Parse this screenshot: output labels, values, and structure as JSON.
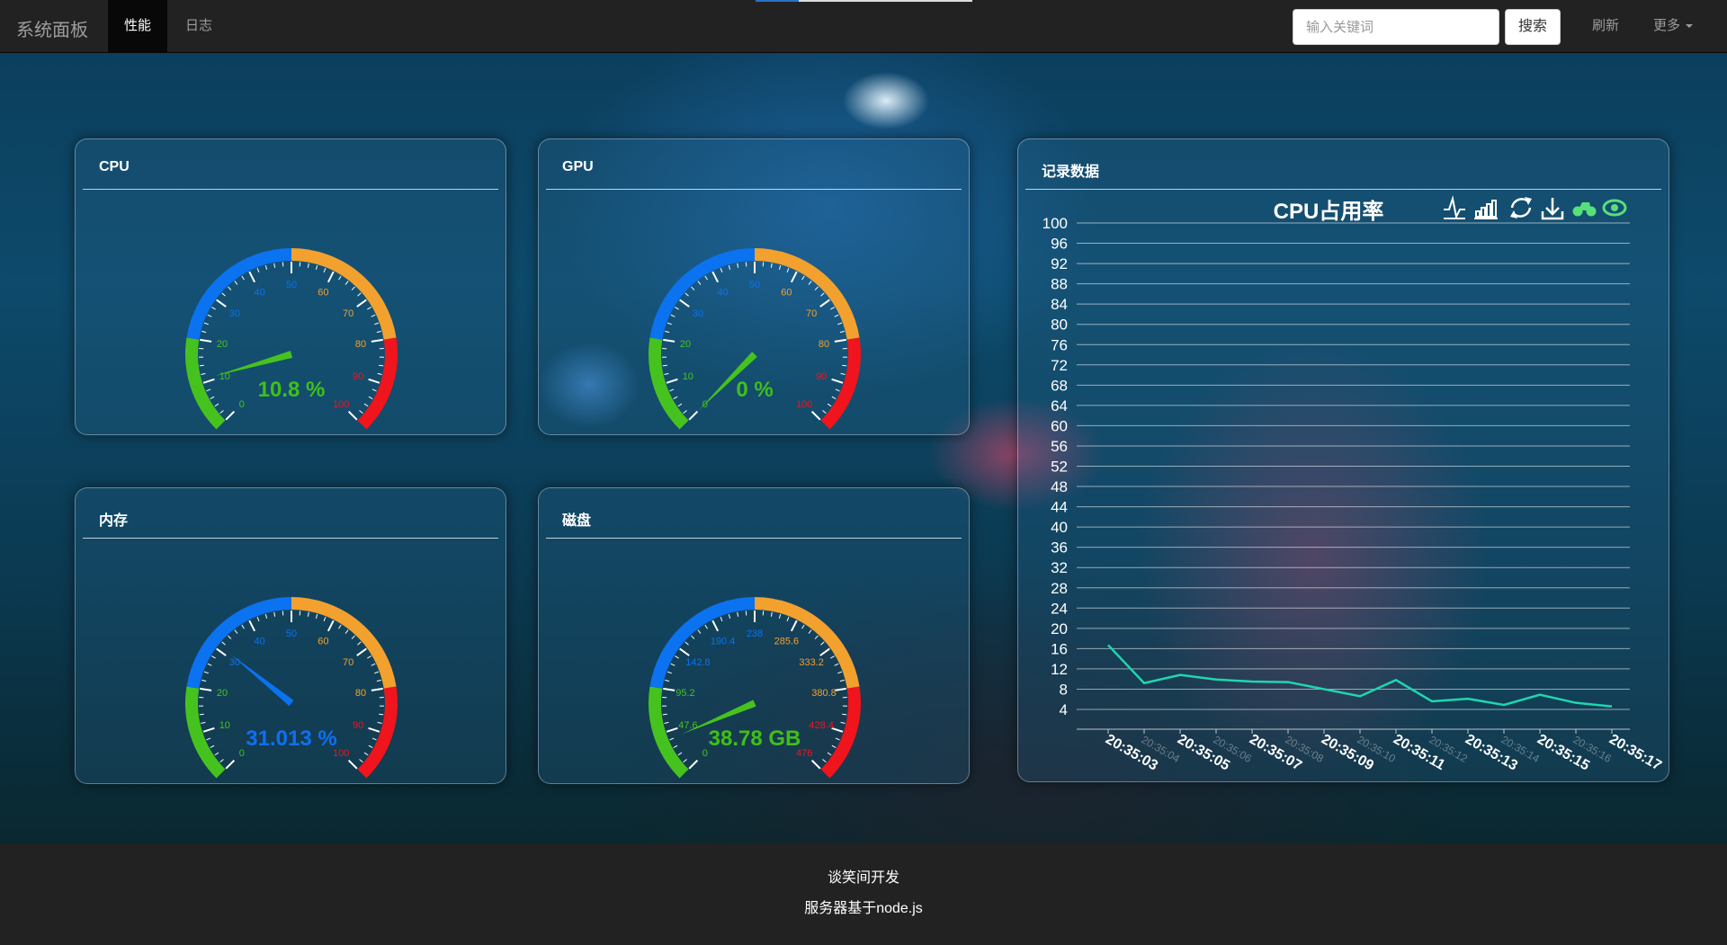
{
  "nav": {
    "brand": "系统面板",
    "tabs": [
      {
        "label": "性能",
        "active": true
      },
      {
        "label": "日志",
        "active": false
      }
    ],
    "search_placeholder": "输入关键词",
    "search_button": "搜索",
    "refresh": "刷新",
    "more": "更多"
  },
  "gauges": [
    {
      "title": "CPU",
      "value": 10.8,
      "display": "10.8 %",
      "min": 0,
      "max": 100,
      "ticks": [
        "0",
        "10",
        "20",
        "30",
        "40",
        "50",
        "60",
        "70",
        "80",
        "90",
        "100"
      ],
      "value_color": "#3fbf1a"
    },
    {
      "title": "GPU",
      "value": 0,
      "display": "0 %",
      "min": 0,
      "max": 100,
      "ticks": [
        "0",
        "10",
        "20",
        "30",
        "40",
        "50",
        "60",
        "70",
        "80",
        "90",
        "100"
      ],
      "value_color": "#3fbf1a"
    },
    {
      "title": "内存",
      "value": 31.013,
      "display": "31.013 %",
      "min": 0,
      "max": 100,
      "ticks": [
        "0",
        "10",
        "20",
        "30",
        "40",
        "50",
        "60",
        "70",
        "80",
        "90",
        "100"
      ],
      "value_color": "#0f6ff2"
    },
    {
      "title": "磁盘",
      "value": 38.78,
      "display": "38.78 GB",
      "min": 0,
      "max": 476,
      "ticks": [
        "0",
        "47.6",
        "95.2",
        "142.8",
        "190.4",
        "238",
        "285.6",
        "333.2",
        "380.8",
        "428.4",
        "476"
      ],
      "value_color": "#3fbf1a"
    }
  ],
  "colors": {
    "green": "#46c21f",
    "blue": "#0b72f0",
    "orange": "#f2a12e",
    "red": "#f0141c",
    "line": "#1fd6b0",
    "toolbox": "#56e07a"
  },
  "record_panel": {
    "title": "记录数据"
  },
  "chart_data": {
    "type": "line",
    "title": "CPU占用率",
    "toolbox_icons": [
      "line-chart-icon",
      "bar-chart-icon",
      "restore-icon",
      "download-icon",
      "bike-icon",
      "eye-icon"
    ],
    "x": [
      "20:35:03",
      "20:35:04",
      "20:35:05",
      "20:35:06",
      "20:35:07",
      "20:35:08",
      "20:35:09",
      "20:35:10",
      "20:35:11",
      "20:35:12",
      "20:35:13",
      "20:35:14",
      "20:35:15",
      "20:35:16",
      "20:35:17"
    ],
    "series": [
      {
        "values": [
          16.7,
          9.2,
          10.8,
          9.9,
          9.5,
          9.4,
          8.0,
          6.6,
          9.8,
          5.6,
          6.1,
          4.9,
          6.9,
          5.3,
          4.6
        ]
      }
    ],
    "ylim": [
      4,
      100
    ],
    "y_ticks": [
      "4",
      "8",
      "12",
      "16",
      "20",
      "24",
      "28",
      "32",
      "36",
      "40",
      "44",
      "48",
      "52",
      "56",
      "60",
      "64",
      "68",
      "72",
      "76",
      "80",
      "84",
      "88",
      "92",
      "96",
      "100"
    ],
    "grid": true
  },
  "footer": {
    "line1": "谈笑间开发",
    "line2": "服务器基于node.js"
  }
}
